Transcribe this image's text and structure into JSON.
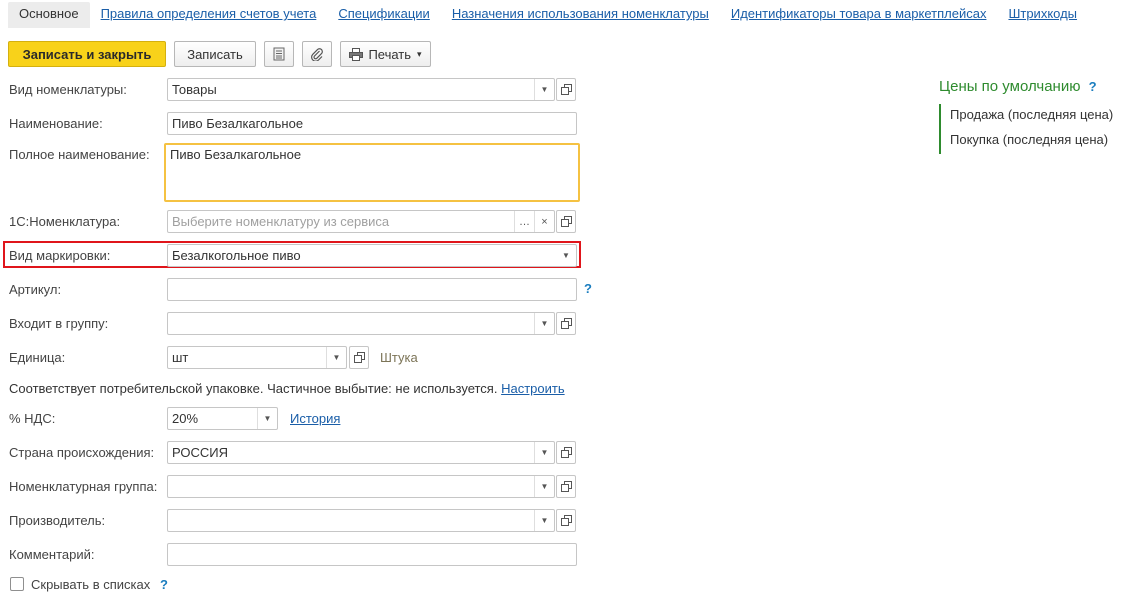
{
  "tabs": [
    {
      "label": "Основное"
    },
    {
      "label": "Правила определения счетов учета"
    },
    {
      "label": "Спецификации"
    },
    {
      "label": "Назначения использования номенклатуры"
    },
    {
      "label": "Идентификаторы товара в маркетплейсах"
    },
    {
      "label": "Штрихкоды"
    }
  ],
  "toolbar": {
    "save_close_label": "Записать и закрыть",
    "save_label": "Записать",
    "report_icon": "document-list-icon",
    "attach_icon": "paperclip-icon",
    "print_label": "Печать",
    "print_icon": "printer-icon"
  },
  "form": {
    "item_type": {
      "label": "Вид номенклатуры:",
      "value": "Товары"
    },
    "name": {
      "label": "Наименование:",
      "value": "Пиво Безалкагольное"
    },
    "full_name": {
      "label": "Полное наименование:",
      "value": "Пиво Безалкагольное"
    },
    "nomenclature_1c": {
      "label": "1С:Номенклатура:",
      "placeholder": "Выберите номенклатуру из сервиса"
    },
    "marking_type": {
      "label": "Вид маркировки:",
      "value": "Безалкогольное пиво"
    },
    "article": {
      "label": "Артикул:",
      "value": "",
      "help": "?"
    },
    "group": {
      "label": "Входит в группу:",
      "value": ""
    },
    "unit": {
      "label": "Единица:",
      "value": "шт",
      "hint": "Штука"
    },
    "package_note": {
      "text": "Соответствует потребительской упаковке. Частичное выбытие: не используется.",
      "link": "Настроить"
    },
    "vat": {
      "label": "% НДС:",
      "value": "20%",
      "history_link": "История"
    },
    "country": {
      "label": "Страна происхождения:",
      "value": "РОССИЯ"
    },
    "item_group": {
      "label": "Номенклатурная группа:",
      "value": ""
    },
    "manufacturer": {
      "label": "Производитель:",
      "value": ""
    },
    "comment": {
      "label": "Комментарий:",
      "value": ""
    },
    "hide_in_lists": {
      "label": "Скрывать в списках",
      "checked": false,
      "help": "?"
    }
  },
  "prices": {
    "title": "Цены по умолчанию",
    "help": "?",
    "items": [
      "Продажа (последняя цена)",
      "Покупка (последняя цена)"
    ]
  },
  "colors": {
    "primary_button": "#f8d21a",
    "highlight_border": "#e0151b",
    "prices_accent": "#2e8b2e",
    "link": "#1a5ea8"
  }
}
